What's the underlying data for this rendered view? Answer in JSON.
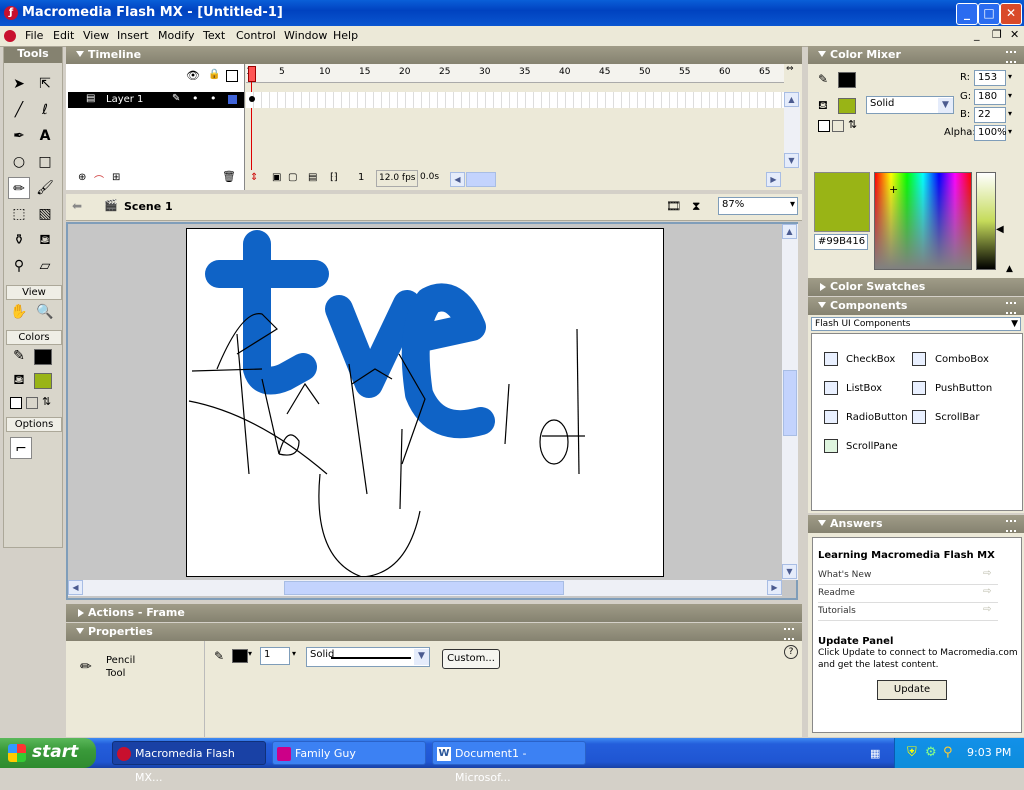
{
  "window": {
    "title": "Macromedia Flash MX - [Untitled-1]",
    "min": "_",
    "max": "□",
    "close": "✕"
  },
  "menu": [
    "File",
    "Edit",
    "View",
    "Insert",
    "Modify",
    "Text",
    "Control",
    "Window",
    "Help"
  ],
  "tools": {
    "header": "Tools",
    "view_label": "View",
    "colors_label": "Colors",
    "options_label": "Options"
  },
  "timeline": {
    "header": "Timeline",
    "layer_name": "Layer 1",
    "frame_numbers": [
      "1",
      "5",
      "10",
      "15",
      "20",
      "25",
      "30",
      "35",
      "40",
      "45",
      "50",
      "55",
      "60",
      "65"
    ],
    "current_frame": "1",
    "fps": "12.0 fps",
    "time": "0.0s"
  },
  "scene": {
    "name": "Scene 1",
    "zoom": "87%"
  },
  "color_mixer": {
    "header": "Color Mixer",
    "fill_type": "Solid",
    "r_label": "R:",
    "r": "153",
    "g_label": "G:",
    "g": "180",
    "b_label": "B:",
    "b": "22",
    "alpha_label": "Alpha:",
    "alpha": "100%",
    "hex": "#99B416",
    "swatch_color": "#99B416"
  },
  "color_swatches": {
    "header": "Color Swatches"
  },
  "components": {
    "header": "Components",
    "set": "Flash UI Components",
    "items": [
      "CheckBox",
      "ComboBox",
      "ListBox",
      "PushButton",
      "RadioButton",
      "ScrollBar",
      "ScrollPane"
    ]
  },
  "answers": {
    "header": "Answers",
    "learning_title": "Learning Macromedia Flash MX",
    "links": [
      "What's New",
      "Readme",
      "Tutorials"
    ],
    "update_title": "Update Panel",
    "update_text_1": "Click Update to connect to Macromedia.com",
    "update_text_2": "and get the latest content.",
    "update_button": "Update"
  },
  "actions": {
    "header": "Actions - Frame"
  },
  "properties": {
    "header": "Properties",
    "tool_line1": "Pencil",
    "tool_line2": "Tool",
    "stroke_height": "1",
    "stroke_style": "Solid",
    "custom_button": "Custom...",
    "help": "?"
  },
  "taskbar": {
    "start": "start",
    "tasks": [
      "Macromedia Flash MX...",
      "Family Guy",
      "Document1 - Microsof..."
    ],
    "clock": "9:03 PM"
  },
  "colors": {
    "stroke_blue": "#0f63c6",
    "fill_green": "#99B416",
    "title_blue": "#0a5fd8"
  }
}
